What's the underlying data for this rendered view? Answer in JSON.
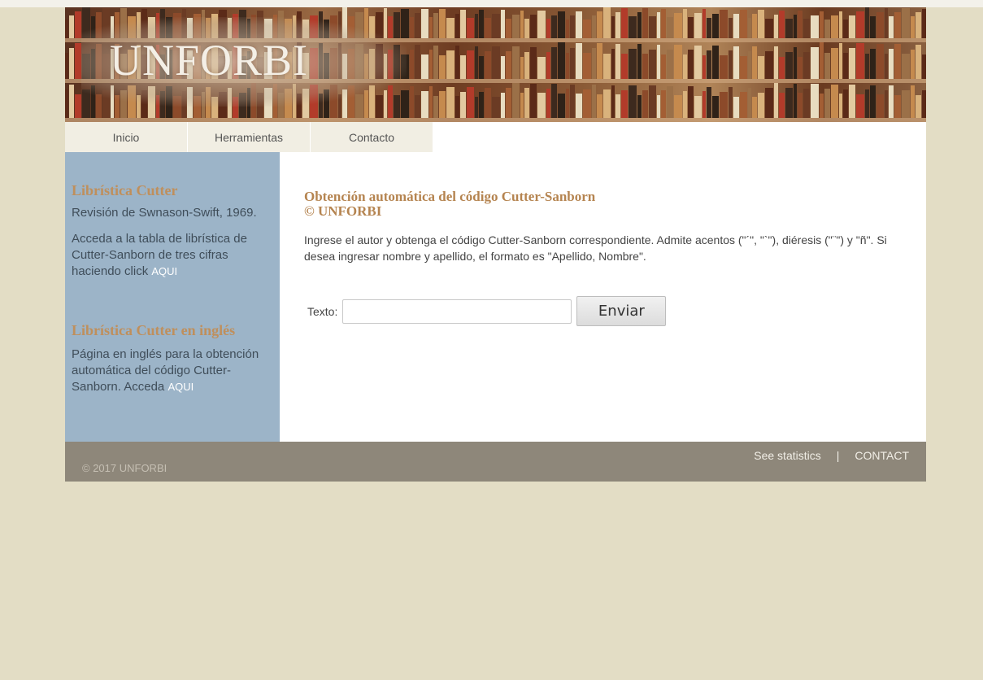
{
  "site": {
    "logo_text": "UNFORBI"
  },
  "nav": {
    "items": [
      {
        "label": "Inicio"
      },
      {
        "label": "Herramientas"
      },
      {
        "label": "Contacto"
      }
    ]
  },
  "sidebar": {
    "section1": {
      "title": "Librística Cutter",
      "line1": "Revisión de Swnason-Swift, 1969.",
      "text": "Acceda a la tabla de librística de Cutter-Sanborn de tres cifras haciendo click",
      "link": "AQUI"
    },
    "section2": {
      "title": "Librística Cutter en inglés",
      "text": "Página en inglés para la obtención automática del código Cutter-Sanborn. Acceda",
      "link": "AQUI"
    }
  },
  "main": {
    "title_line1": "Obtención automática del código Cutter-Sanborn",
    "title_line2": "© UNFORBI",
    "description": "Ingrese el autor y obtenga el código Cutter-Sanborn correspondiente. Admite acentos (\"´\", \"`\"), diéresis (\"¨\") y \"ñ\". Si desea ingresar nombre y apellido, el formato es \"Apellido, Nombre\".",
    "form": {
      "label": "Texto:",
      "input_value": "",
      "button": "Enviar"
    }
  },
  "footer": {
    "copyright": "© 2017 UNFORBI",
    "stats_link": "See statistics",
    "separator": "|",
    "contact_link": "CONTACT"
  }
}
